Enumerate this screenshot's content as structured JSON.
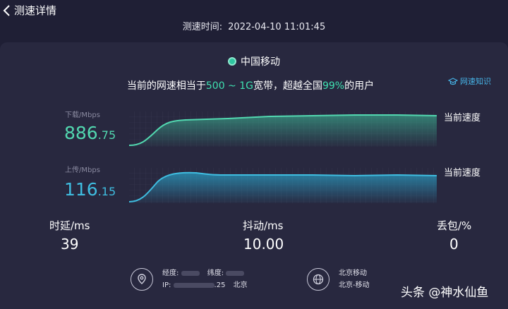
{
  "header": {
    "title": "测速详情",
    "time_label": "测速时间:",
    "time_value": "2022-04-10 11:01:45"
  },
  "isp": {
    "name": "中国移动"
  },
  "summary": {
    "prefix": "当前的网速相当于",
    "range": "500 ~ 1G",
    "middle": "宽带，超越全国",
    "percent": "99%",
    "suffix": "的用户"
  },
  "knowledge_link": "网速知识",
  "download": {
    "label": "下载/Mbps",
    "value_int": "886",
    "value_dec": ".75",
    "tag": "当前速度",
    "color": "#52d8b0"
  },
  "upload": {
    "label": "上传/Mbps",
    "value_int": "116",
    "value_dec": ".15",
    "tag": "当前速度",
    "color": "#3fbde0"
  },
  "stats": {
    "latency": {
      "label": "时延/ms",
      "value": "39"
    },
    "jitter": {
      "label": "抖动/ms",
      "value": "10.00"
    },
    "packet_loss": {
      "label": "丢包/%",
      "value": "0"
    }
  },
  "footer": {
    "location_icon": "location-pin-icon",
    "longitude_label": "经度:",
    "latitude_label": "纬度:",
    "ip_label": "IP:",
    "ip_suffix": ".25",
    "ip_city": "北京",
    "network_icon": "globe-icon",
    "operator": "北京移动",
    "operator_region": "北京-移动"
  },
  "watermark": "头条 @神水仙鱼"
}
